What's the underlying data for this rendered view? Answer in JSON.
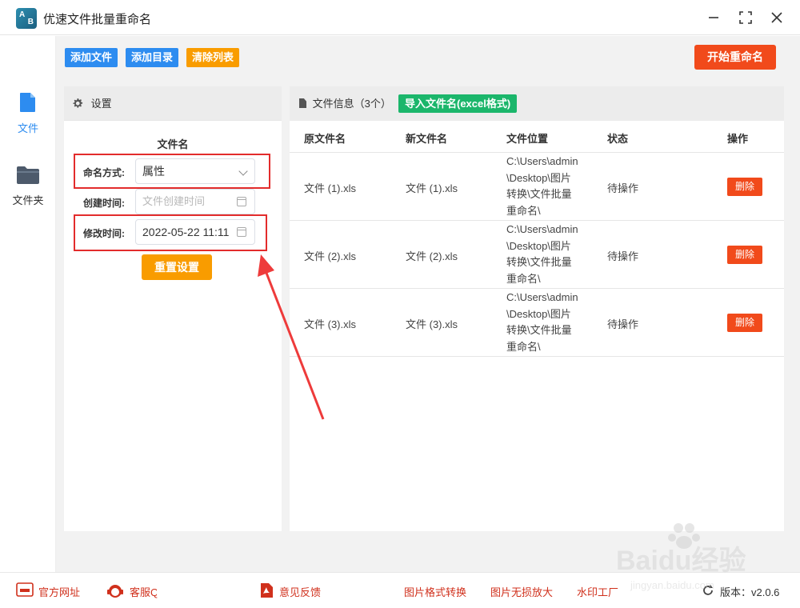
{
  "window": {
    "title": "优速文件批量重命名",
    "logo_letters": [
      "A",
      "B"
    ]
  },
  "sidebar": {
    "items": [
      {
        "label": "文件",
        "icon": "file-icon",
        "active": true
      },
      {
        "label": "文件夹",
        "icon": "folder-icon",
        "active": false
      }
    ]
  },
  "toolbar": {
    "add_file": "添加文件",
    "add_dir": "添加目录",
    "clear_list": "清除列表",
    "start": "开始重命名"
  },
  "settings": {
    "header": "设置",
    "section_title": "文件名",
    "naming_label": "命名方式:",
    "naming_value": "属性",
    "created_label": "创建时间:",
    "created_placeholder": "文件创建时间",
    "modified_label": "修改时间:",
    "modified_value": "2022-05-22 11:11",
    "reset": "重置设置"
  },
  "files": {
    "header": "文件信息（3个）",
    "import_btn": "导入文件名(excel格式)",
    "columns": [
      "原文件名",
      "新文件名",
      "文件位置",
      "状态",
      "操作"
    ],
    "rows": [
      {
        "orig": "文件 (1).xls",
        "new": "文件 (1).xls",
        "loc": "C:\\Users\\admin\\Desktop\\图片转换\\文件批量重命名\\",
        "status": "待操作",
        "action": "删除"
      },
      {
        "orig": "文件 (2).xls",
        "new": "文件 (2).xls",
        "loc": "C:\\Users\\admin\\Desktop\\图片转换\\文件批量重命名\\",
        "status": "待操作",
        "action": "删除"
      },
      {
        "orig": "文件 (3).xls",
        "new": "文件 (3).xls",
        "loc": "C:\\Users\\admin\\Desktop\\图片转换\\文件批量重命名\\",
        "status": "待操作",
        "action": "删除"
      }
    ]
  },
  "footer": {
    "website": "官方网址",
    "service": "客服Q",
    "feedback": "意见反馈",
    "img_convert": "图片格式转换",
    "img_enlarge": "图片无损放大",
    "watermark": "水印工厂",
    "version": "版本：v2.0.6"
  },
  "colors": {
    "blue": "#2d8cf0",
    "orange": "#f99c00",
    "red": "#f14a1b",
    "green": "#1bb66b",
    "annotation_red": "#e32c2c"
  },
  "watermark_text": {
    "brand": "Baidu经验",
    "url": "jingyan.baidu.com"
  }
}
